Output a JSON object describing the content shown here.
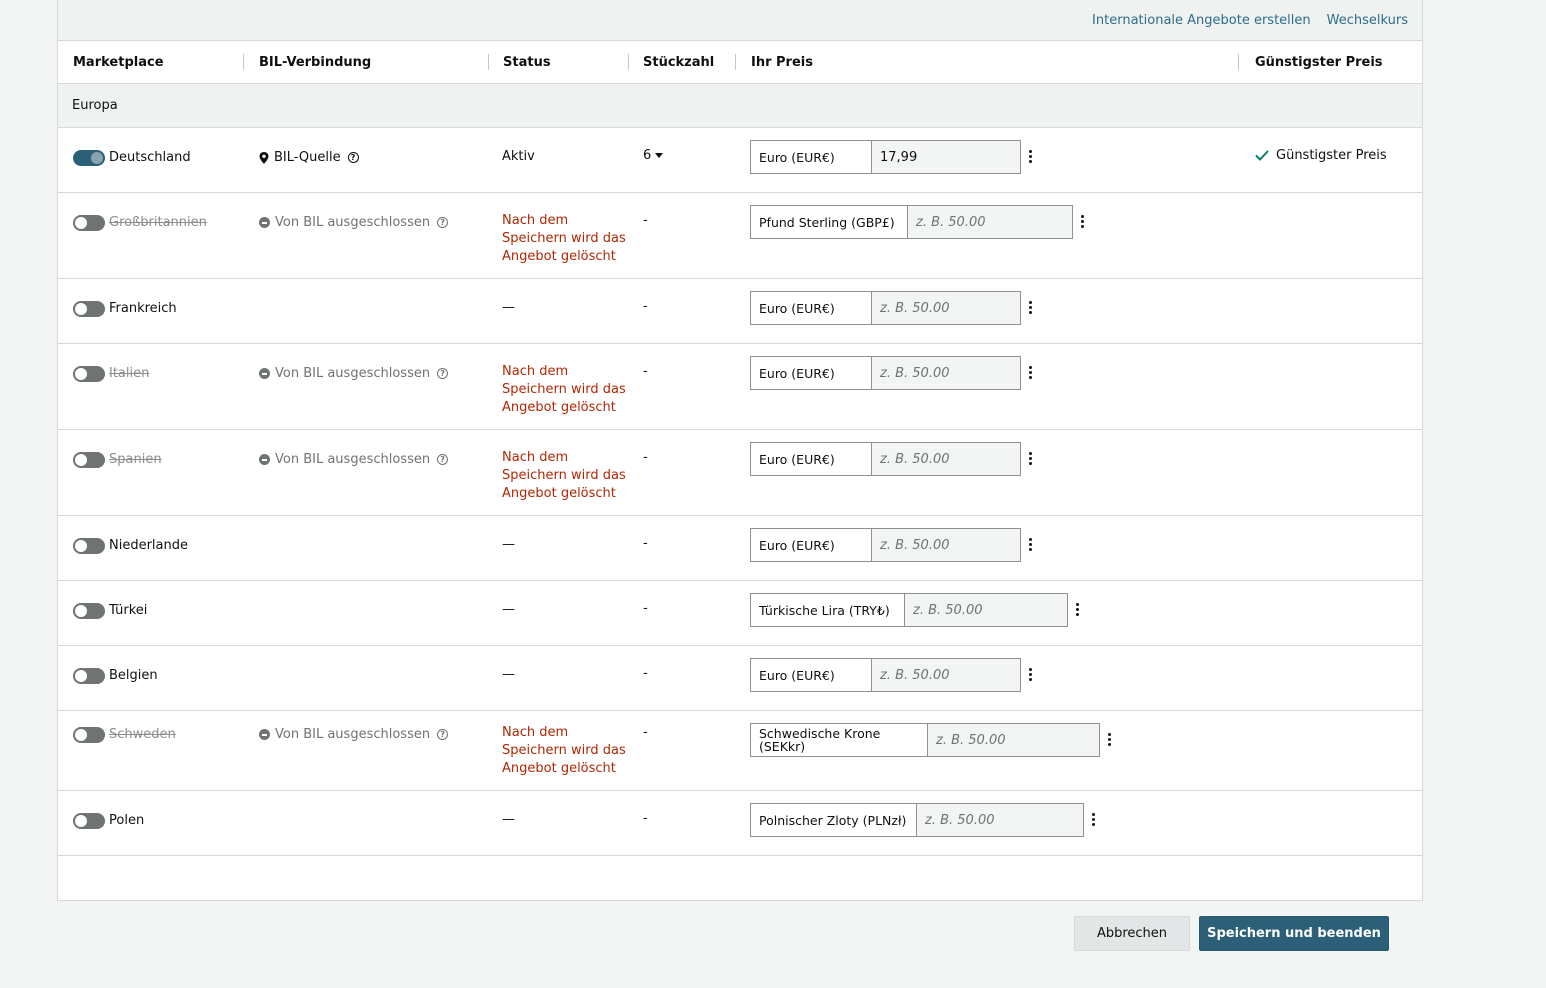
{
  "top_links": {
    "create_international": "Internationale Angebote erstellen",
    "exchange_rate": "Wechselkurs"
  },
  "columns": {
    "marketplace": "Marketplace",
    "bil_connection": "BIL-Verbindung",
    "status": "Status",
    "quantity": "Stückzahl",
    "your_price": "Ihr Preis",
    "lowest_price": "Günstigster Preis"
  },
  "group_label": "Europa",
  "texts": {
    "excluded": "Von BIL ausgeschlossen",
    "bil_source": "BIL-Quelle",
    "warn": "Nach dem Speichern wird das Angebot gelöscht",
    "dash_status": "—",
    "dash_qty": "-",
    "placeholder": "z. B. 50.00"
  },
  "rows": [
    {
      "name": "Deutschland",
      "status": "Aktiv",
      "quantity": "6",
      "currency": "Euro (EUR€)",
      "price": "17,99",
      "best": "Günstigster Preis"
    },
    {
      "name": "Großbritannien",
      "currency": "Pfund Sterling (GBP£)"
    },
    {
      "name": "Frankreich",
      "currency": "Euro (EUR€)"
    },
    {
      "name": "Italien",
      "currency": "Euro (EUR€)"
    },
    {
      "name": "Spanien",
      "currency": "Euro (EUR€)"
    },
    {
      "name": "Niederlande",
      "currency": "Euro (EUR€)"
    },
    {
      "name": "Türkei",
      "currency": "Türkische Lira (TRY₺)"
    },
    {
      "name": "Belgien",
      "currency": "Euro (EUR€)"
    },
    {
      "name": "Schweden",
      "currency": "Schwedische Krone (SEKkr)"
    },
    {
      "name": "Polen",
      "currency": "Polnischer Zloty (PLNzł)"
    }
  ],
  "buttons": {
    "cancel": "Abbrechen",
    "save": "Speichern und beenden"
  },
  "colors": {
    "accent": "#2b6078",
    "link": "#2b6d8a",
    "warning": "#b12704",
    "success": "#067d62"
  }
}
